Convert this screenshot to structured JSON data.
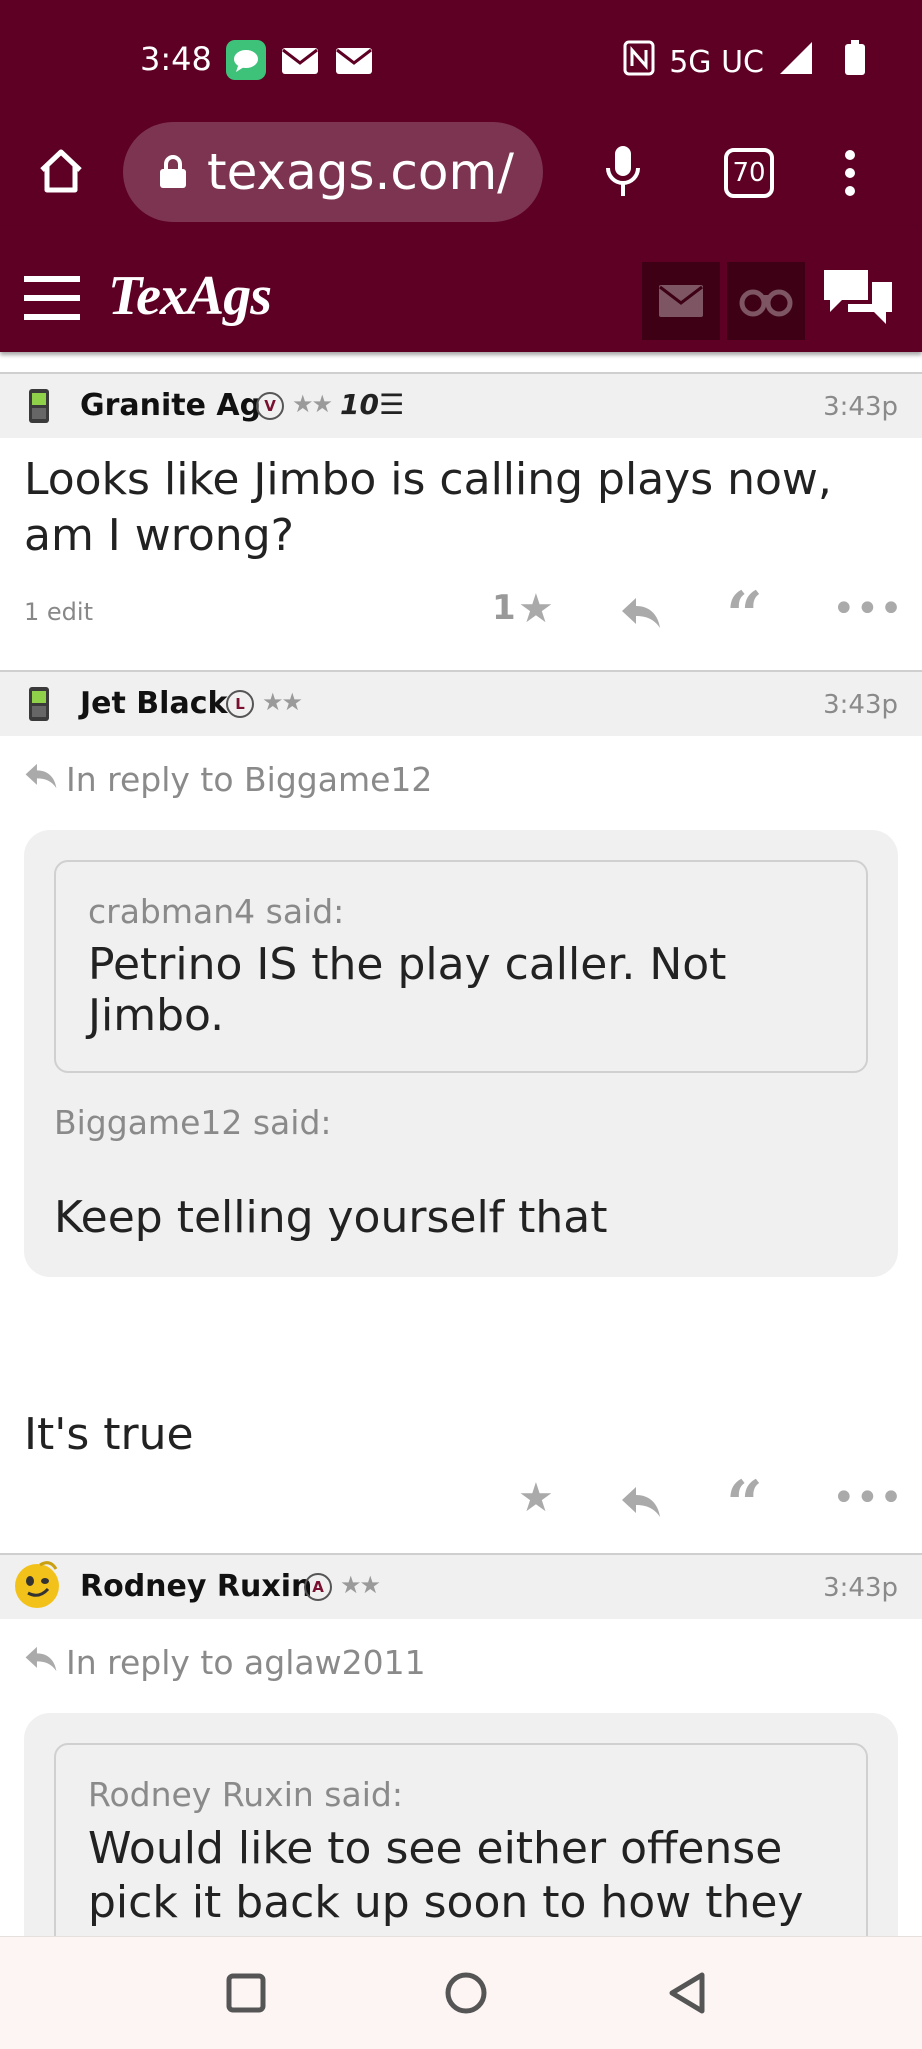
{
  "status_bar": {
    "time": "3:48",
    "network": "5G UC"
  },
  "browser": {
    "url": "texags.com/",
    "tab_count": "70"
  },
  "site": {
    "logo": "TexAgs"
  },
  "posts": [
    {
      "username": "Granite Ag",
      "badge": "V",
      "stars": "★★",
      "rank": "10☰",
      "time": "3:43p",
      "text": "Looks like Jimbo is calling plays now, am I wrong?",
      "edit_note": "1 edit",
      "star_count": "1"
    },
    {
      "username": "Jet Black",
      "badge": "L",
      "stars": "★★",
      "time": "3:43p",
      "reply_to": "In reply to Biggame12",
      "inner_quote": {
        "said": "crabman4 said:",
        "text": "Petrino IS the play caller. Not Jimbo."
      },
      "outer_quote": {
        "said": "Biggame12 said:",
        "text": "Keep telling yourself that"
      },
      "text": "It's true"
    },
    {
      "username": "Rodney Ruxin",
      "badge": "A",
      "stars": "★★",
      "time": "3:43p",
      "reply_to": "In reply to aglaw2011",
      "inner_quote": {
        "said": "Rodney Ruxin said:",
        "text": "Would like to see either offense pick it back up soon to how they"
      }
    }
  ]
}
